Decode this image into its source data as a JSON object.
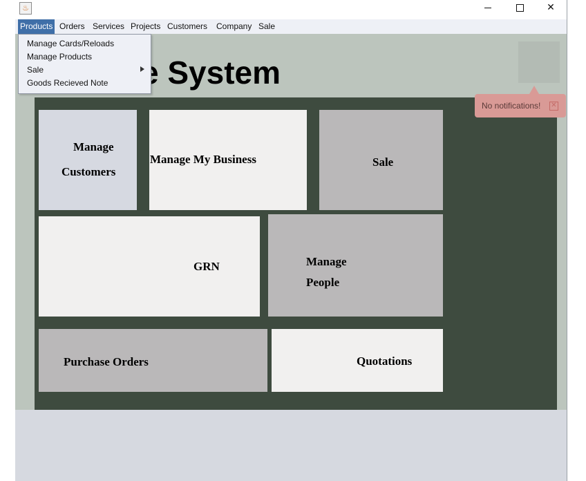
{
  "window": {
    "app_icon": "java-cup-icon",
    "app_icon_glyph": "♨",
    "min_icon": "minimize-icon",
    "max_icon": "maximize-icon",
    "close_icon": "close-icon",
    "close_glyph": "✕"
  },
  "menubar": {
    "items": [
      "Products",
      "Orders",
      "Services",
      "Projects",
      "Customers",
      "Company",
      "Sale"
    ],
    "active": "Products"
  },
  "products_menu": {
    "items": [
      "Manage Cards/Reloads",
      "Manage Products",
      "Sale",
      "Goods Recieved Note"
    ],
    "submenu_icon": "submenu-arrow-icon"
  },
  "header": {
    "title": "e System"
  },
  "notification": {
    "text": "No notifications!",
    "close_glyph": "✕"
  },
  "tiles": {
    "manage_customers": [
      "Manage",
      "Customers"
    ],
    "manage_my_business": "Manage My Business",
    "sale": "Sale",
    "grn": "GRN",
    "manage_people": [
      "Manage",
      "People"
    ],
    "purchase_orders": "Purchase Orders",
    "quotations": "Quotations"
  },
  "colors": {
    "menu_active": "#3f6fa8",
    "header_band": "#bcc5bd",
    "dashboard": "#3e4b3f",
    "tile_white": "#f1f0ef",
    "tile_gray": "#bab8b9",
    "tile_blue": "#d6d9e1",
    "notification": "#d99a96"
  }
}
